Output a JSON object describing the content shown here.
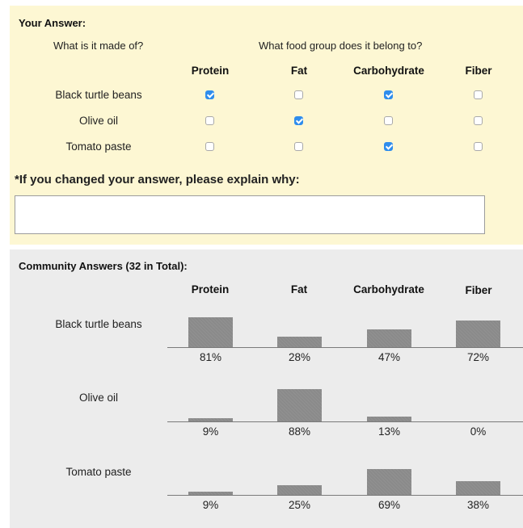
{
  "your_answer": {
    "title": "Your Answer:",
    "question_made_of": "What is it made of?",
    "question_group": "What food group does it belong to?",
    "columns": [
      "Protein",
      "Fat",
      "Carbohydrate",
      "Fiber"
    ],
    "rows": [
      {
        "label": "Black turtle beans",
        "checks": [
          true,
          false,
          true,
          false
        ]
      },
      {
        "label": "Olive oil",
        "checks": [
          false,
          true,
          false,
          false
        ]
      },
      {
        "label": "Tomato paste",
        "checks": [
          false,
          false,
          true,
          false
        ]
      }
    ],
    "explain_label": "*If you changed your answer, please explain why:",
    "explain_value": ""
  },
  "community": {
    "title": "Community Answers (32 in Total):",
    "columns": [
      "Protein",
      "Fat",
      "Carbohydrate",
      "Fiber"
    ],
    "rows": [
      {
        "label": "Black turtle beans",
        "percents": [
          81,
          28,
          47,
          72
        ],
        "labels": [
          "81%",
          "28%",
          "47%",
          "72%"
        ]
      },
      {
        "label": "Olive oil",
        "percents": [
          9,
          88,
          13,
          0
        ],
        "labels": [
          "9%",
          "88%",
          "13%",
          "0%"
        ]
      },
      {
        "label": "Tomato paste",
        "percents": [
          9,
          25,
          69,
          38
        ],
        "labels": [
          "9%",
          "25%",
          "69%",
          "38%"
        ]
      }
    ],
    "colors": {
      "bar": "#8a8a8a",
      "baseline": "#7a7a7a"
    }
  },
  "colors": {
    "answer_bg": "#fdf7d3",
    "community_bg": "#ececec",
    "checkbox_checked": "#2f8ded"
  }
}
